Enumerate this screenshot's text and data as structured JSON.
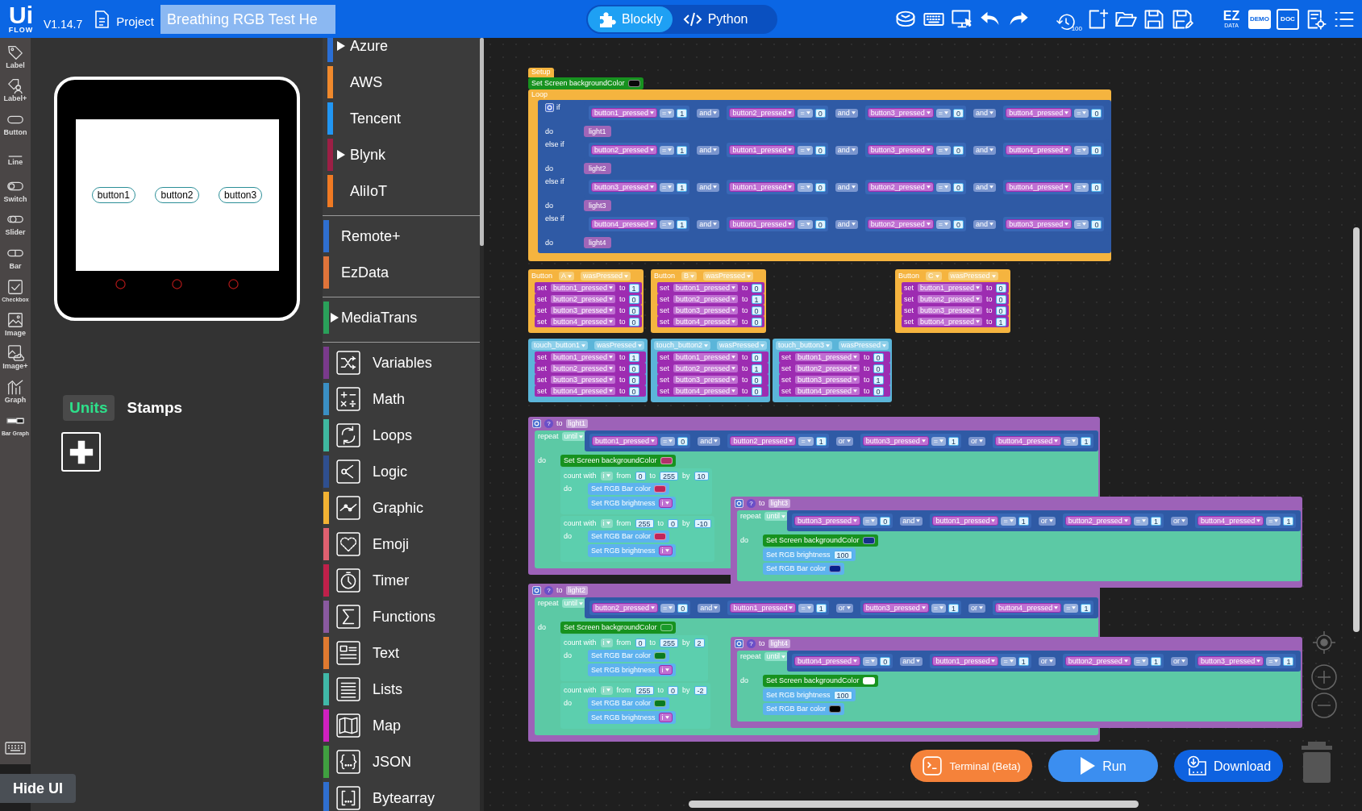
{
  "topbar": {
    "logo_top": "Ui",
    "logo_bottom": "FLOW",
    "version": "V1.14.7",
    "project_label": "Project",
    "project_name": "Breathing RGB Test He",
    "modes": [
      {
        "label": "Blockly",
        "kind": "blockly",
        "selected": true
      },
      {
        "label": "Python",
        "kind": "python",
        "selected": false
      }
    ],
    "tools": [
      {
        "kind": "firmware"
      },
      {
        "kind": "keyboard"
      },
      {
        "kind": "device"
      },
      {
        "kind": "undo"
      },
      {
        "kind": "redo"
      },
      {
        "kind": "history",
        "text": "100"
      },
      {
        "kind": "new"
      },
      {
        "kind": "open"
      },
      {
        "kind": "save"
      },
      {
        "kind": "save_as"
      },
      {
        "kind": "ezdata",
        "text": "EZ",
        "subtext": "DATA"
      },
      {
        "kind": "demo",
        "text": "DEMO"
      },
      {
        "kind": "doc",
        "text": "DOC"
      },
      {
        "kind": "settings"
      },
      {
        "kind": "menu"
      }
    ]
  },
  "widgets": [
    {
      "label": "Label",
      "kind": "label"
    },
    {
      "label": "Label+",
      "kind": "label_plus"
    },
    {
      "label": "Button",
      "kind": "button"
    },
    {
      "label": "Line",
      "kind": "line"
    },
    {
      "label": "Switch",
      "kind": "switch"
    },
    {
      "label": "Slider",
      "kind": "slider"
    },
    {
      "label": "Bar",
      "kind": "bar"
    },
    {
      "label": "Checkbox",
      "kind": "checkbox"
    },
    {
      "label": "Image",
      "kind": "image"
    },
    {
      "label": "Image+",
      "kind": "image_plus"
    },
    {
      "label": "Graph",
      "kind": "graph"
    },
    {
      "label": "Bar Graph",
      "kind": "bar_graph"
    }
  ],
  "device": {
    "buttons": [
      "button1",
      "button2",
      "button3"
    ]
  },
  "panel_tabs": [
    {
      "label": "Units",
      "selected": true
    },
    {
      "label": "Stamps",
      "selected": false
    }
  ],
  "hide_ui": "Hide UI",
  "palette": [
    {
      "items": [
        {
          "label": "Azure",
          "color": "#2a6fd6",
          "expandable": true
        },
        {
          "label": "AWS",
          "color": "#f0892c",
          "expandable": false
        },
        {
          "label": "Tencent",
          "color": "#2196f3",
          "expandable": false
        },
        {
          "label": "Blynk",
          "color": "#9c1f45",
          "expandable": true
        },
        {
          "label": "AliIoT",
          "color": "#f07a23",
          "expandable": false
        }
      ]
    },
    {
      "items": [
        {
          "label": "Remote+",
          "color": "#2f6fd0",
          "expandable": false
        },
        {
          "label": "EzData",
          "color": "#e0743a",
          "expandable": false
        }
      ]
    },
    {
      "items": [
        {
          "label": "MediaTrans",
          "color": "#2aa05a",
          "expandable": true
        }
      ]
    },
    {
      "items": [
        {
          "label": "Variables",
          "color": "#7a3a8c",
          "kind": "variables"
        },
        {
          "label": "Math",
          "color": "#3a8fc4",
          "kind": "math"
        },
        {
          "label": "Loops",
          "color": "#3fb8a0",
          "kind": "loops"
        },
        {
          "label": "Logic",
          "color": "#2f4f8f",
          "kind": "logic"
        },
        {
          "label": "Graphic",
          "color": "#f2b233",
          "kind": "graphic"
        },
        {
          "label": "Emoji",
          "color": "#e06070",
          "kind": "emoji"
        },
        {
          "label": "Timer",
          "color": "#c0204a",
          "kind": "timer"
        },
        {
          "label": "Functions",
          "color": "#8a5aa0",
          "kind": "functions"
        },
        {
          "label": "Text",
          "color": "#e07a30",
          "kind": "text"
        },
        {
          "label": "Lists",
          "color": "#40b8a8",
          "kind": "lists"
        },
        {
          "label": "Map",
          "color": "#d020c0",
          "kind": "map"
        },
        {
          "label": "JSON",
          "color": "#40a040",
          "kind": "json"
        },
        {
          "label": "Bytearray",
          "color": "#2f6fd0",
          "kind": "bytearray"
        }
      ]
    }
  ],
  "workspace": {
    "stacks": [
      {
        "kind": "setup",
        "hat": "Setup",
        "statements": [
          {
            "kind": "screen_color",
            "label": "Set Screen backgroundColor",
            "color": "#0a0a0a"
          }
        ],
        "loop": "Loop",
        "branches": [
          {
            "keyword": "if",
            "do": "do",
            "call": "light1",
            "condition": {
              "terms": [
                {
                  "var": "button1_pressed",
                  "op": "=",
                  "value": "1"
                },
                {
                  "var": "button2_pressed",
                  "op": "=",
                  "value": "0"
                },
                {
                  "var": "button3_pressed",
                  "op": "=",
                  "value": "0"
                },
                {
                  "var": "button4_pressed",
                  "op": "=",
                  "value": "0"
                }
              ],
              "joins": [
                "and",
                "and",
                "and"
              ]
            }
          },
          {
            "keyword": "else if",
            "do": "do",
            "call": "light2",
            "condition": {
              "terms": [
                {
                  "var": "button2_pressed",
                  "op": "=",
                  "value": "1"
                },
                {
                  "var": "button1_pressed",
                  "op": "=",
                  "value": "0"
                },
                {
                  "var": "button3_pressed",
                  "op": "=",
                  "value": "0"
                },
                {
                  "var": "button4_pressed",
                  "op": "=",
                  "value": "0"
                }
              ],
              "joins": [
                "and",
                "and",
                "and"
              ]
            }
          },
          {
            "keyword": "else if",
            "do": "do",
            "call": "light3",
            "condition": {
              "terms": [
                {
                  "var": "button3_pressed",
                  "op": "=",
                  "value": "1"
                },
                {
                  "var": "button1_pressed",
                  "op": "=",
                  "value": "0"
                },
                {
                  "var": "button2_pressed",
                  "op": "=",
                  "value": "0"
                },
                {
                  "var": "button4_pressed",
                  "op": "=",
                  "value": "0"
                }
              ],
              "joins": [
                "and",
                "and",
                "and"
              ]
            }
          },
          {
            "keyword": "else if",
            "do": "do",
            "call": "light4",
            "condition": {
              "terms": [
                {
                  "var": "button4_pressed",
                  "op": "=",
                  "value": "1"
                },
                {
                  "var": "button1_pressed",
                  "op": "=",
                  "value": "0"
                },
                {
                  "var": "button2_pressed",
                  "op": "=",
                  "value": "0"
                },
                {
                  "var": "button3_pressed",
                  "op": "=",
                  "value": "0"
                }
              ],
              "joins": [
                "and",
                "and",
                "and"
              ]
            }
          }
        ]
      },
      {
        "kind": "button_event",
        "label": "Button",
        "source": "A",
        "event": "wasPressed",
        "sets": [
          {
            "set": "set",
            "var": "button1_pressed",
            "to": "to",
            "value": "1"
          },
          {
            "set": "set",
            "var": "button2_pressed",
            "to": "to",
            "value": "0"
          },
          {
            "set": "set",
            "var": "button3_pressed",
            "to": "to",
            "value": "0"
          },
          {
            "set": "set",
            "var": "button4_pressed",
            "to": "to",
            "value": "0"
          }
        ]
      },
      {
        "kind": "button_event",
        "label": "Button",
        "source": "B",
        "event": "wasPressed",
        "sets": [
          {
            "set": "set",
            "var": "button1_pressed",
            "to": "to",
            "value": "0"
          },
          {
            "set": "set",
            "var": "button2_pressed",
            "to": "to",
            "value": "1"
          },
          {
            "set": "set",
            "var": "button3_pressed",
            "to": "to",
            "value": "0"
          },
          {
            "set": "set",
            "var": "button4_pressed",
            "to": "to",
            "value": "0"
          }
        ]
      },
      {
        "kind": "button_event",
        "label": "Button",
        "source": "C",
        "event": "wasPressed",
        "sets": [
          {
            "set": "set",
            "var": "button1_pressed",
            "to": "to",
            "value": "0"
          },
          {
            "set": "set",
            "var": "button2_pressed",
            "to": "to",
            "value": "0"
          },
          {
            "set": "set",
            "var": "button3_pressed",
            "to": "to",
            "value": "0"
          },
          {
            "set": "set",
            "var": "button4_pressed",
            "to": "to",
            "value": "1"
          }
        ]
      },
      {
        "kind": "touch_event",
        "source": "touch_button1",
        "event": "wasPressed",
        "sets": [
          {
            "set": "set",
            "var": "button1_pressed",
            "to": "to",
            "value": "1"
          },
          {
            "set": "set",
            "var": "button2_pressed",
            "to": "to",
            "value": "0"
          },
          {
            "set": "set",
            "var": "button3_pressed",
            "to": "to",
            "value": "0"
          },
          {
            "set": "set",
            "var": "button4_pressed",
            "to": "to",
            "value": "0"
          }
        ]
      },
      {
        "kind": "touch_event",
        "source": "touch_button2",
        "event": "wasPressed",
        "sets": [
          {
            "set": "set",
            "var": "button1_pressed",
            "to": "to",
            "value": "0"
          },
          {
            "set": "set",
            "var": "button2_pressed",
            "to": "to",
            "value": "1"
          },
          {
            "set": "set",
            "var": "button3_pressed",
            "to": "to",
            "value": "0"
          },
          {
            "set": "set",
            "var": "button4_pressed",
            "to": "to",
            "value": "0"
          }
        ]
      },
      {
        "kind": "touch_event",
        "source": "touch_button3",
        "event": "wasPressed",
        "sets": [
          {
            "set": "set",
            "var": "button1_pressed",
            "to": "to",
            "value": "0"
          },
          {
            "set": "set",
            "var": "button2_pressed",
            "to": "to",
            "value": "0"
          },
          {
            "set": "set",
            "var": "button3_pressed",
            "to": "to",
            "value": "1"
          },
          {
            "set": "set",
            "var": "button4_pressed",
            "to": "to",
            "value": "0"
          }
        ]
      },
      {
        "kind": "function",
        "help": "?",
        "to": "to",
        "name": "light1",
        "repeat": "repeat",
        "until": "until",
        "do": "do",
        "condition": {
          "terms": [
            {
              "var": "button1_pressed",
              "op": "=",
              "value": "0"
            },
            {
              "var": "button2_pressed",
              "op": "=",
              "value": "1"
            },
            {
              "var": "button3_pressed",
              "op": "=",
              "value": "1"
            },
            {
              "var": "button4_pressed",
              "op": "=",
              "value": "1"
            }
          ],
          "joins": [
            "and",
            "or",
            "or"
          ]
        },
        "body": [
          {
            "kind": "screen_color",
            "label": "Set Screen backgroundColor",
            "color": "#b0306a"
          },
          {
            "kind": "count",
            "label": "count with",
            "var": "i",
            "from_label": "from",
            "from": "0",
            "to_label": "to",
            "to": "255",
            "by_label": "by",
            "by": "10",
            "do": "do",
            "body": [
              {
                "kind": "rgb_color",
                "label": "Set RGB Bar color",
                "color": "#c0245a"
              },
              {
                "kind": "rgb_value",
                "label": "Set RGB brightness",
                "arg": {
                  "kind": "var",
                  "text": "i"
                }
              }
            ]
          },
          {
            "kind": "count",
            "label": "count with",
            "var": "i",
            "from_label": "from",
            "from": "255",
            "to_label": "to",
            "to": "0",
            "by_label": "by",
            "by": "-10",
            "do": "do",
            "body": [
              {
                "kind": "rgb_color",
                "label": "Set RGB Bar color",
                "color": "#c0245a"
              },
              {
                "kind": "rgb_value",
                "label": "Set RGB brightness",
                "arg": {
                  "kind": "var",
                  "text": "i"
                }
              }
            ]
          }
        ]
      },
      {
        "kind": "function",
        "help": "?",
        "to": "to",
        "name": "light3",
        "repeat": "repeat",
        "until": "until",
        "do": "do",
        "condition": {
          "terms": [
            {
              "var": "button3_pressed",
              "op": "=",
              "value": "0"
            },
            {
              "var": "button1_pressed",
              "op": "=",
              "value": "1"
            },
            {
              "var": "button2_pressed",
              "op": "=",
              "value": "1"
            },
            {
              "var": "button4_pressed",
              "op": "=",
              "value": "1"
            }
          ],
          "joins": [
            "and",
            "or",
            "or"
          ]
        },
        "body": [
          {
            "kind": "screen_color",
            "label": "Set Screen backgroundColor",
            "color": "#14308a"
          },
          {
            "kind": "rgb_value",
            "label": "Set RGB brightness",
            "arg": {
              "kind": "number",
              "text": "100"
            }
          },
          {
            "kind": "rgb_color",
            "label": "Set RGB Bar color",
            "color": "#0a1f8a"
          }
        ]
      },
      {
        "kind": "function",
        "help": "?",
        "to": "to",
        "name": "light2",
        "repeat": "repeat",
        "until": "until",
        "do": "do",
        "condition": {
          "terms": [
            {
              "var": "button2_pressed",
              "op": "=",
              "value": "0"
            },
            {
              "var": "button1_pressed",
              "op": "=",
              "value": "1"
            },
            {
              "var": "button3_pressed",
              "op": "=",
              "value": "1"
            },
            {
              "var": "button4_pressed",
              "op": "=",
              "value": "1"
            }
          ],
          "joins": [
            "and",
            "or",
            "or"
          ]
        },
        "body": [
          {
            "kind": "screen_color",
            "label": "Set Screen backgroundColor",
            "color": "#1a9a2a"
          },
          {
            "kind": "count",
            "label": "count with",
            "var": "i",
            "from_label": "from",
            "from": "0",
            "to_label": "to",
            "to": "255",
            "by_label": "by",
            "by": "2",
            "do": "do",
            "body": [
              {
                "kind": "rgb_color",
                "label": "Set RGB Bar color",
                "color": "#0a7a20"
              },
              {
                "kind": "rgb_value",
                "label": "Set RGB brightness",
                "arg": {
                  "kind": "var",
                  "text": "i"
                }
              }
            ]
          },
          {
            "kind": "count",
            "label": "count with",
            "var": "i",
            "from_label": "from",
            "from": "255",
            "to_label": "to",
            "to": "0",
            "by_label": "by",
            "by": "-2",
            "do": "do",
            "body": [
              {
                "kind": "rgb_color",
                "label": "Set RGB Bar color",
                "color": "#0a7a20"
              },
              {
                "kind": "rgb_value",
                "label": "Set RGB brightness",
                "arg": {
                  "kind": "var",
                  "text": "i"
                }
              }
            ]
          }
        ]
      },
      {
        "kind": "function",
        "help": "?",
        "to": "to",
        "name": "light4",
        "repeat": "repeat",
        "until": "until",
        "do": "do",
        "condition": {
          "terms": [
            {
              "var": "button4_pressed",
              "op": "=",
              "value": "0"
            },
            {
              "var": "button1_pressed",
              "op": "=",
              "value": "1"
            },
            {
              "var": "button2_pressed",
              "op": "=",
              "value": "1"
            },
            {
              "var": "button3_pressed",
              "op": "=",
              "value": "1"
            }
          ],
          "joins": [
            "and",
            "or",
            "or"
          ]
        },
        "body": [
          {
            "kind": "screen_color",
            "label": "Set Screen backgroundColor",
            "color": "#ffffff"
          },
          {
            "kind": "rgb_value",
            "label": "Set RGB brightness",
            "arg": {
              "kind": "number",
              "text": "100"
            }
          },
          {
            "kind": "rgb_color",
            "label": "Set RGB Bar color",
            "color": "#000000"
          }
        ]
      }
    ]
  },
  "actions": [
    {
      "label": "Terminal (Beta)",
      "kind": "terminal"
    },
    {
      "label": "Run",
      "kind": "run"
    },
    {
      "label": "Download",
      "kind": "download"
    }
  ]
}
